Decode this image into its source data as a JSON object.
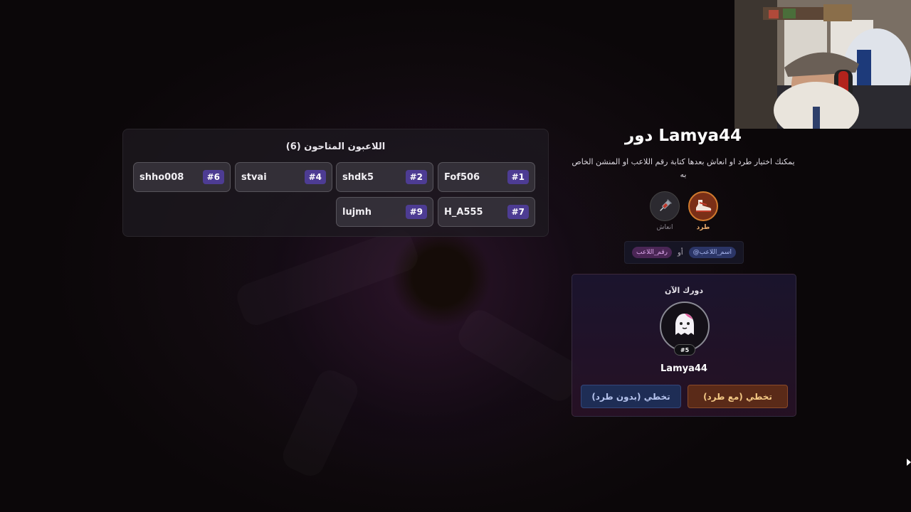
{
  "players_panel": {
    "title": "اللاعبون المتاحون (6)",
    "players": [
      {
        "name": "Fof506",
        "number": "#1"
      },
      {
        "name": "shdk5",
        "number": "#2"
      },
      {
        "name": "stvai",
        "number": "#4"
      },
      {
        "name": "shho008",
        "number": "#6"
      },
      {
        "name": "H_A555",
        "number": "#7"
      },
      {
        "name": "lujmh",
        "number": "#9"
      }
    ]
  },
  "turn": {
    "title": "دور Lamya44",
    "instructions": "يمكنك اختيار طرد او انعاش بعدها كتابة رقم اللاعب او المنشن الخاص به",
    "actions": {
      "kick_label": "طرد",
      "kick_icon": "boot-icon",
      "revive_label": "انعاش",
      "revive_icon": "syringe-icon"
    },
    "hint": {
      "mention_tag": "@اسم_اللاعب",
      "or": "أو",
      "number_tag": "رقم_اللاعب"
    }
  },
  "current_turn": {
    "label": "دورك الآن",
    "avatar_icon": "ghost-icon",
    "player_number": "#5",
    "player_name": "Lamya44",
    "skip_with_kick": "تخطي (مع طرد)",
    "skip_without_kick": "تخطي (بدون طرد)"
  },
  "colors": {
    "number_badge": "#4d3c93",
    "kick_accent": "#d07a2e",
    "skip_kick_text": "#f4c985",
    "skip_nokick_bg": "#1e2d55"
  }
}
